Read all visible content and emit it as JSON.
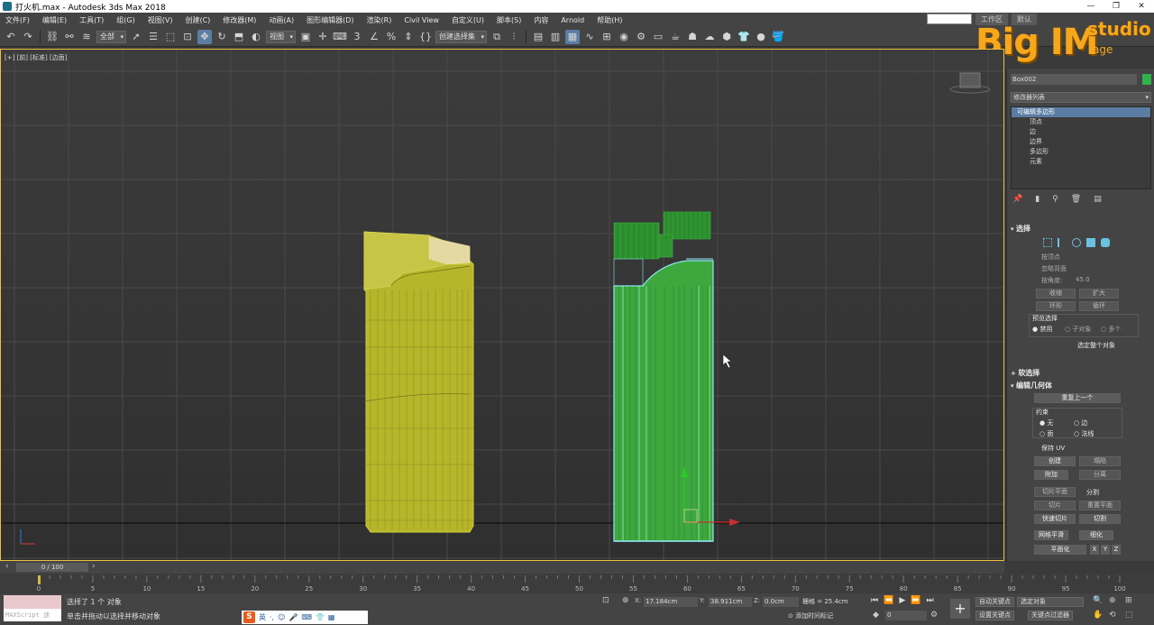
{
  "window": {
    "title": "打火机.max - Autodesk 3ds Max 2018",
    "controls": [
      "—",
      "❐",
      "✕"
    ]
  },
  "menu": [
    "文件(F)",
    "编辑(E)",
    "工具(T)",
    "组(G)",
    "视图(V)",
    "创建(C)",
    "修改器(M)",
    "动画(A)",
    "图形编辑器(D)",
    "渲染(R)",
    "Civil View",
    "自定义(U)",
    "脚本(S)",
    "内容",
    "Arnold",
    "帮助(H)"
  ],
  "menu_right": {
    "workspace": "工作区",
    "default": "默认"
  },
  "toolbar": {
    "filter_dropdown": "全部",
    "view_dropdown": "视图",
    "selection_set_dropdown": "创建选择集"
  },
  "watermark": {
    "big": "Big IM",
    "studio": "studio",
    "age": "age"
  },
  "viewport": {
    "label": "[+] [前] [标准] [边面]",
    "active_border_color": "#f0c040",
    "left_object_color": "#b7b62a",
    "right_object_color": "#3ea83e",
    "selection_color": "#8fe8f0"
  },
  "command_panel": {
    "object_name": "Box002",
    "object_color": "#2fb24a",
    "modifier_list": "修改器列表",
    "stack": [
      "可编辑多边形",
      "顶点",
      "边",
      "边界",
      "多边形",
      "元素"
    ],
    "selection_rollout": {
      "title": "选择",
      "by_vertex": "按顶点",
      "ignore_backfacing": "忽略背面",
      "by_angle": "按角度:",
      "angle_value": "45.0",
      "shrink": "收缩",
      "grow": "扩大",
      "ring": "环形",
      "loop": "循环",
      "preview_title": "预览选择",
      "preview_options": [
        "禁用",
        "子对象",
        "多个"
      ],
      "selected_info": "选定整个对象"
    },
    "soft_selection": "软选择",
    "edit_geometry": {
      "title": "编辑几何体",
      "repeat_last": "重复上一个",
      "constraints_title": "约束",
      "constraints": [
        "无",
        "边",
        "面",
        "法线"
      ],
      "preserve_uv": "保持 UV",
      "create": "创建",
      "collapse": "塌陷",
      "attach": "附加",
      "detach": "分离",
      "slice_plane": "切片平面",
      "split": "分割",
      "slice": "切片",
      "reset_plane": "重置平面",
      "quickslice": "快速切片",
      "cut": "切割",
      "msmooth": "网格平滑",
      "tessellate": "细化",
      "make_planar": "平面化",
      "axes": [
        "X",
        "Y",
        "Z"
      ]
    }
  },
  "timeline": {
    "frame_counter": "0 / 100",
    "ticks": [
      0,
      5,
      10,
      15,
      20,
      25,
      30,
      35,
      40,
      45,
      50,
      55,
      60,
      65,
      70,
      75,
      80,
      85,
      90,
      95,
      100
    ]
  },
  "status": {
    "maxscript_label": "MAXScript 迷",
    "line1": "选择了 1 个 对象",
    "line2": "单击并拖动以选择并移动对象",
    "x_label": "X:",
    "x_value": "17.184cm",
    "y_label": "Y:",
    "y_value": "38.911cm",
    "z_label": "Z:",
    "z_value": "0.0cm",
    "grid": "栅格 = 25.4cm",
    "add_time_tag": "添加时间标记",
    "frame_value": "0",
    "auto_key": "自动关键点",
    "selected_object": "选定对象",
    "set_key": "设置关键点",
    "key_filters": "关键点过滤器",
    "ime_lang": "英"
  }
}
